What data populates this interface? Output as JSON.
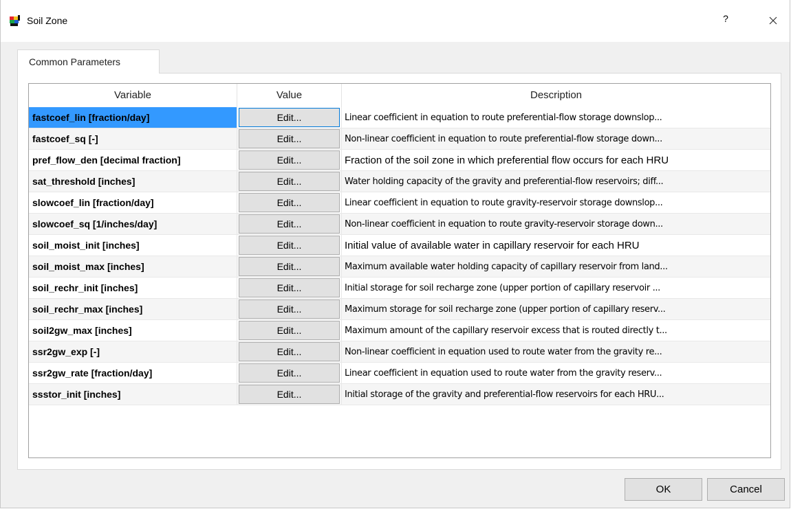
{
  "window": {
    "title": "Soil Zone",
    "help_label": "?",
    "close_icon": "close-icon",
    "app_icon": "soil-zone-app-icon"
  },
  "tabs": [
    {
      "label": "Common Parameters",
      "active": true
    }
  ],
  "table": {
    "headers": [
      "Variable",
      "Value",
      "Description"
    ],
    "rows": [
      {
        "variable": "fastcoef_lin [fraction/day]",
        "value": "Edit...",
        "description": "Linear coefficient in equation to route preferential-flow storage downslop..."
      },
      {
        "variable": "fastcoef_sq [-]",
        "value": "Edit...",
        "description": "Non-linear coefficient in equation to route preferential-flow storage down..."
      },
      {
        "variable": "pref_flow_den [decimal fraction]",
        "value": "Edit...",
        "description": "Fraction of the soil zone in which preferential flow occurs for each HRU"
      },
      {
        "variable": "sat_threshold [inches]",
        "value": "Edit...",
        "description": "Water holding capacity of the gravity and preferential-flow reservoirs; diff..."
      },
      {
        "variable": "slowcoef_lin [fraction/day]",
        "value": "Edit...",
        "description": "Linear coefficient in equation to route gravity-reservoir storage downslop..."
      },
      {
        "variable": "slowcoef_sq [1/inches/day]",
        "value": "Edit...",
        "description": "Non-linear coefficient in equation to route gravity-reservoir storage down..."
      },
      {
        "variable": "soil_moist_init [inches]",
        "value": "Edit...",
        "description": "Initial value of available water in capillary reservoir for each HRU"
      },
      {
        "variable": "soil_moist_max [inches]",
        "value": "Edit...",
        "description": "Maximum available water holding capacity of capillary reservoir from land..."
      },
      {
        "variable": "soil_rechr_init [inches]",
        "value": "Edit...",
        "description": "Initial storage for soil recharge zone (upper portion of capillary reservoir ..."
      },
      {
        "variable": "soil_rechr_max [inches]",
        "value": "Edit...",
        "description": "Maximum storage for soil recharge zone (upper portion of capillary reserv..."
      },
      {
        "variable": "soil2gw_max [inches]",
        "value": "Edit...",
        "description": "Maximum amount of the capillary reservoir excess that is routed directly t..."
      },
      {
        "variable": "ssr2gw_exp [-]",
        "value": "Edit...",
        "description": "Non-linear coefficient in equation used to route water from the gravity re..."
      },
      {
        "variable": "ssr2gw_rate [fraction/day]",
        "value": "Edit...",
        "description": "Linear coefficient in equation used to route water from the gravity reserv..."
      },
      {
        "variable": "ssstor_init [inches]",
        "value": "Edit...",
        "description": "Initial storage of the gravity and preferential-flow reservoirs for each HRU..."
      }
    ]
  },
  "buttons": {
    "ok": "OK",
    "cancel": "Cancel"
  },
  "colors": {
    "selection": "#3399ff",
    "focus_border": "#0078d7",
    "button_face": "#e1e1e1"
  }
}
